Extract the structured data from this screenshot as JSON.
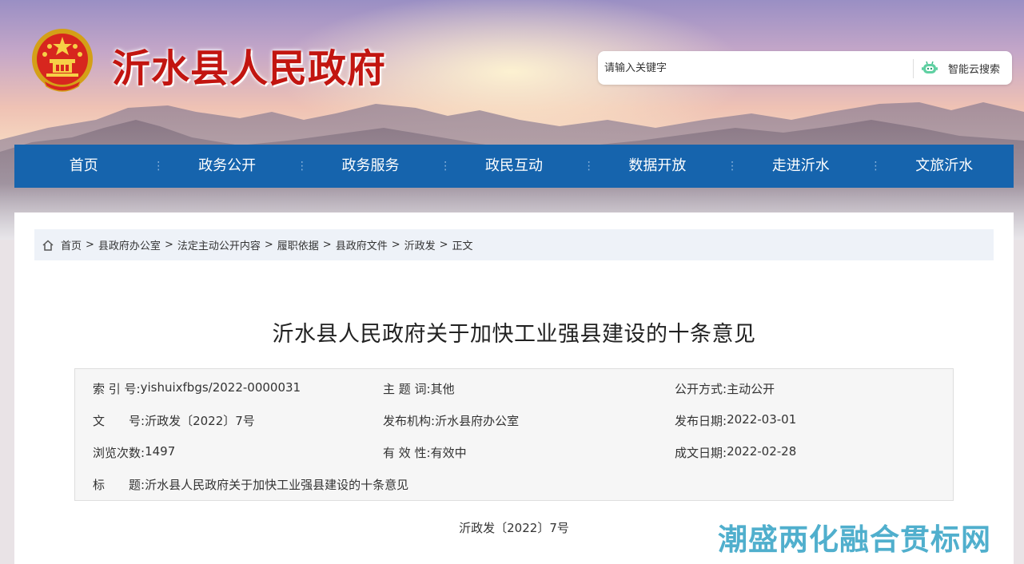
{
  "header": {
    "site_title": "沂水县人民政府",
    "emblem_icon": "national-emblem-icon"
  },
  "search": {
    "placeholder": "请输入关键字",
    "button_label": "智能云搜索",
    "button_icon": "robot-icon"
  },
  "nav": {
    "items": [
      {
        "label": "首页"
      },
      {
        "label": "政务公开"
      },
      {
        "label": "政务服务"
      },
      {
        "label": "政民互动"
      },
      {
        "label": "数据开放"
      },
      {
        "label": "走进沂水"
      },
      {
        "label": "文旅沂水"
      }
    ],
    "separator": "⋮"
  },
  "breadcrumb": {
    "home_icon": "home-icon",
    "items": [
      "首页",
      "县政府办公室",
      "法定主动公开内容",
      "履职依据",
      "县政府文件",
      "沂政发",
      "正文"
    ],
    "separator": ">"
  },
  "article": {
    "title": "沂水县人民政府关于加快工业强县建设的十条意见",
    "doc_number": "沂政发〔2022〕7号"
  },
  "meta": {
    "index_label": "索 引 号:",
    "index_value": "yishuixfbgs/2022-0000031",
    "topic_label": "主 题 词:",
    "topic_value": "其他",
    "disclosure_label": "公开方式:",
    "disclosure_value": "主动公开",
    "docno_label": "文　　号:",
    "docno_value": "沂政发〔2022〕7号",
    "issuer_label": "发布机构:",
    "issuer_value": "沂水县府办公室",
    "pubdate_label": "发布日期:",
    "pubdate_value": "2022-03-01",
    "views_label": "浏览次数:",
    "views_value": "1497",
    "validity_label": "有 效 性:",
    "validity_value": "有效中",
    "created_label": "成文日期:",
    "created_value": "2022-02-28",
    "title_label": "标　　题:",
    "title_value": "沂水县人民政府关于加快工业强县建设的十条意见"
  },
  "watermark": {
    "text": "潮盛两化融合贯标网"
  },
  "colors": {
    "nav_bg": "#1664ad",
    "title_red": "#c21510",
    "breadcrumb_bg": "#eef2f8",
    "watermark": "#3ea7c8"
  }
}
